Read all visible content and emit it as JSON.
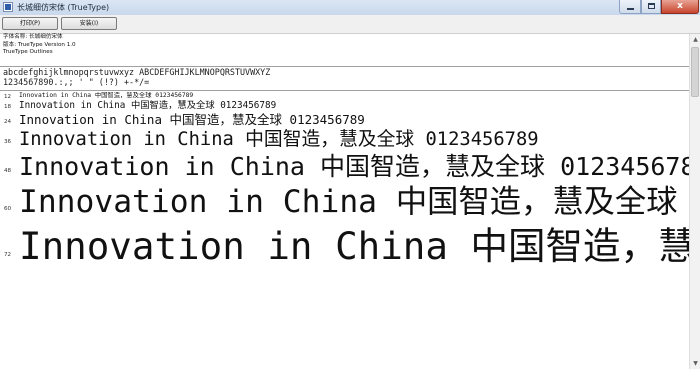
{
  "window": {
    "title": "长城细仿宋体 (TrueType)",
    "close_glyph": "x"
  },
  "toolbar": {
    "print_label": "打印(P)",
    "install_label": "安装(I)"
  },
  "info": {
    "font_name": "字体名称: 长城细仿宋体",
    "version": "版本: TrueType Version 1.0",
    "format": "TrueType Outlines"
  },
  "charset": {
    "line1": "abcdefghijklmnopqrstuvwxyz ABCDEFGHIJKLMNOPQRSTUVWXYZ",
    "line2": "1234567890.:,;  ' \" (!?) +-*/="
  },
  "sample": {
    "text": "Innovation in China 中国智造，慧及全球 0123456789",
    "sizes": [
      "12",
      "18",
      "24",
      "36",
      "48",
      "60",
      "72"
    ]
  },
  "scrollbar": {
    "up_glyph": "▲",
    "down_glyph": "▼"
  }
}
